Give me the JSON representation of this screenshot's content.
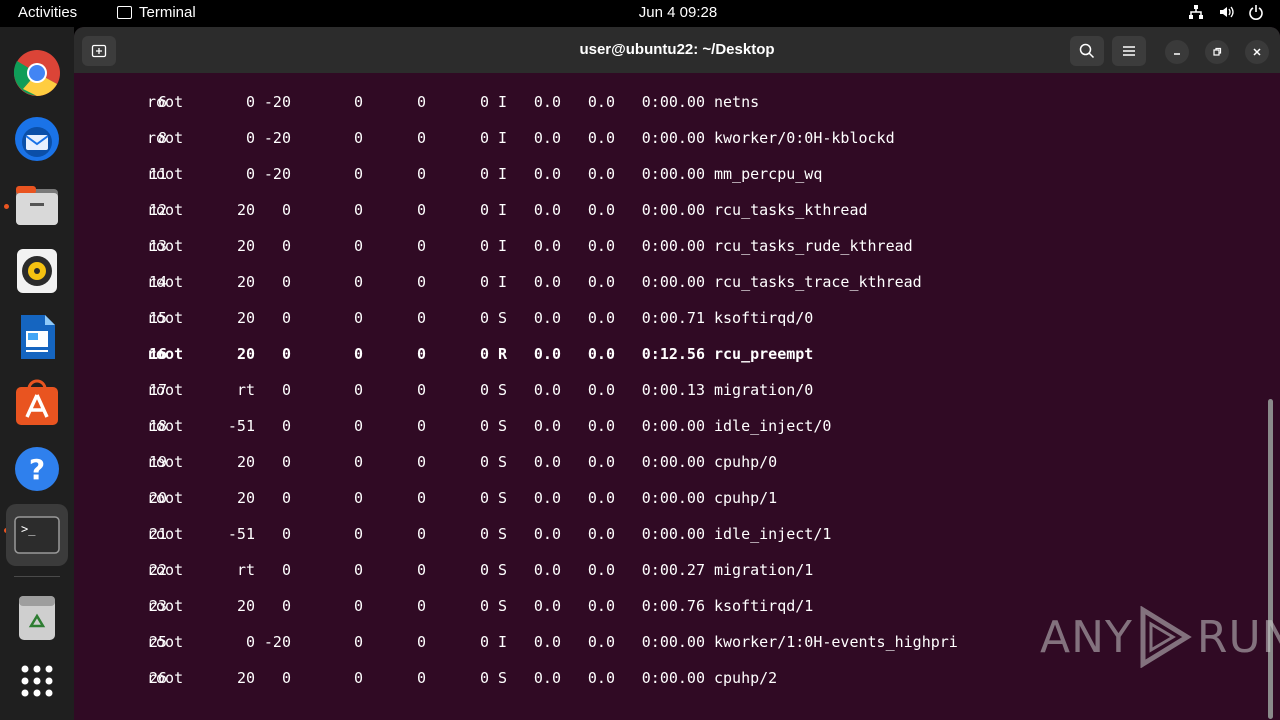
{
  "topbar": {
    "activities": "Activities",
    "app_name": "Terminal",
    "clock": "Jun 4  09:28",
    "tray_icons": [
      "network-icon",
      "volume-icon",
      "power-icon"
    ]
  },
  "dock": {
    "apps": [
      {
        "name": "chrome",
        "running": false
      },
      {
        "name": "thunderbird",
        "running": false
      },
      {
        "name": "files",
        "running": true
      },
      {
        "name": "rhythmbox",
        "running": false
      },
      {
        "name": "libreoffice-writer",
        "running": false
      },
      {
        "name": "app-center",
        "running": false
      },
      {
        "name": "help",
        "running": false
      },
      {
        "name": "terminal",
        "running": true
      },
      {
        "name": "trash",
        "running": false
      },
      {
        "name": "show-apps",
        "running": false
      }
    ]
  },
  "window": {
    "title": "user@ubuntu22: ~/Desktop",
    "colors": {
      "background": "#300a24",
      "titlebar": "#2c2c2c",
      "text": "#ffffff"
    }
  },
  "processes": [
    {
      "pid": "6",
      "user": "root",
      "pr": "0",
      "ni": "-20",
      "virt": "0",
      "res": "0",
      "shr": "0",
      "s": "I",
      "cpu": "0.0",
      "mem": "0.0",
      "time": "0:00.00",
      "command": "netns",
      "bold": false
    },
    {
      "pid": "8",
      "user": "root",
      "pr": "0",
      "ni": "-20",
      "virt": "0",
      "res": "0",
      "shr": "0",
      "s": "I",
      "cpu": "0.0",
      "mem": "0.0",
      "time": "0:00.00",
      "command": "kworker/0:0H-kblockd",
      "bold": false
    },
    {
      "pid": "11",
      "user": "root",
      "pr": "0",
      "ni": "-20",
      "virt": "0",
      "res": "0",
      "shr": "0",
      "s": "I",
      "cpu": "0.0",
      "mem": "0.0",
      "time": "0:00.00",
      "command": "mm_percpu_wq",
      "bold": false
    },
    {
      "pid": "12",
      "user": "root",
      "pr": "20",
      "ni": "0",
      "virt": "0",
      "res": "0",
      "shr": "0",
      "s": "I",
      "cpu": "0.0",
      "mem": "0.0",
      "time": "0:00.00",
      "command": "rcu_tasks_kthread",
      "bold": false
    },
    {
      "pid": "13",
      "user": "root",
      "pr": "20",
      "ni": "0",
      "virt": "0",
      "res": "0",
      "shr": "0",
      "s": "I",
      "cpu": "0.0",
      "mem": "0.0",
      "time": "0:00.00",
      "command": "rcu_tasks_rude_kthread",
      "bold": false
    },
    {
      "pid": "14",
      "user": "root",
      "pr": "20",
      "ni": "0",
      "virt": "0",
      "res": "0",
      "shr": "0",
      "s": "I",
      "cpu": "0.0",
      "mem": "0.0",
      "time": "0:00.00",
      "command": "rcu_tasks_trace_kthread",
      "bold": false
    },
    {
      "pid": "15",
      "user": "root",
      "pr": "20",
      "ni": "0",
      "virt": "0",
      "res": "0",
      "shr": "0",
      "s": "S",
      "cpu": "0.0",
      "mem": "0.0",
      "time": "0:00.71",
      "command": "ksoftirqd/0",
      "bold": false
    },
    {
      "pid": "16",
      "user": "root",
      "pr": "20",
      "ni": "0",
      "virt": "0",
      "res": "0",
      "shr": "0",
      "s": "R",
      "cpu": "0.0",
      "mem": "0.0",
      "time": "0:12.56",
      "command": "rcu_preempt",
      "bold": true
    },
    {
      "pid": "17",
      "user": "root",
      "pr": "rt",
      "ni": "0",
      "virt": "0",
      "res": "0",
      "shr": "0",
      "s": "S",
      "cpu": "0.0",
      "mem": "0.0",
      "time": "0:00.13",
      "command": "migration/0",
      "bold": false
    },
    {
      "pid": "18",
      "user": "root",
      "pr": "-51",
      "ni": "0",
      "virt": "0",
      "res": "0",
      "shr": "0",
      "s": "S",
      "cpu": "0.0",
      "mem": "0.0",
      "time": "0:00.00",
      "command": "idle_inject/0",
      "bold": false
    },
    {
      "pid": "19",
      "user": "root",
      "pr": "20",
      "ni": "0",
      "virt": "0",
      "res": "0",
      "shr": "0",
      "s": "S",
      "cpu": "0.0",
      "mem": "0.0",
      "time": "0:00.00",
      "command": "cpuhp/0",
      "bold": false
    },
    {
      "pid": "20",
      "user": "root",
      "pr": "20",
      "ni": "0",
      "virt": "0",
      "res": "0",
      "shr": "0",
      "s": "S",
      "cpu": "0.0",
      "mem": "0.0",
      "time": "0:00.00",
      "command": "cpuhp/1",
      "bold": false
    },
    {
      "pid": "21",
      "user": "root",
      "pr": "-51",
      "ni": "0",
      "virt": "0",
      "res": "0",
      "shr": "0",
      "s": "S",
      "cpu": "0.0",
      "mem": "0.0",
      "time": "0:00.00",
      "command": "idle_inject/1",
      "bold": false
    },
    {
      "pid": "22",
      "user": "root",
      "pr": "rt",
      "ni": "0",
      "virt": "0",
      "res": "0",
      "shr": "0",
      "s": "S",
      "cpu": "0.0",
      "mem": "0.0",
      "time": "0:00.27",
      "command": "migration/1",
      "bold": false
    },
    {
      "pid": "23",
      "user": "root",
      "pr": "20",
      "ni": "0",
      "virt": "0",
      "res": "0",
      "shr": "0",
      "s": "S",
      "cpu": "0.0",
      "mem": "0.0",
      "time": "0:00.76",
      "command": "ksoftirqd/1",
      "bold": false
    },
    {
      "pid": "25",
      "user": "root",
      "pr": "0",
      "ni": "-20",
      "virt": "0",
      "res": "0",
      "shr": "0",
      "s": "I",
      "cpu": "0.0",
      "mem": "0.0",
      "time": "0:00.00",
      "command": "kworker/1:0H-events_highpri",
      "bold": false
    },
    {
      "pid": "26",
      "user": "root",
      "pr": "20",
      "ni": "0",
      "virt": "0",
      "res": "0",
      "shr": "0",
      "s": "S",
      "cpu": "0.0",
      "mem": "0.0",
      "time": "0:00.00",
      "command": "cpuhp/2",
      "bold": false
    }
  ],
  "watermark": {
    "text_left": "ANY",
    "text_right": "RUN"
  }
}
